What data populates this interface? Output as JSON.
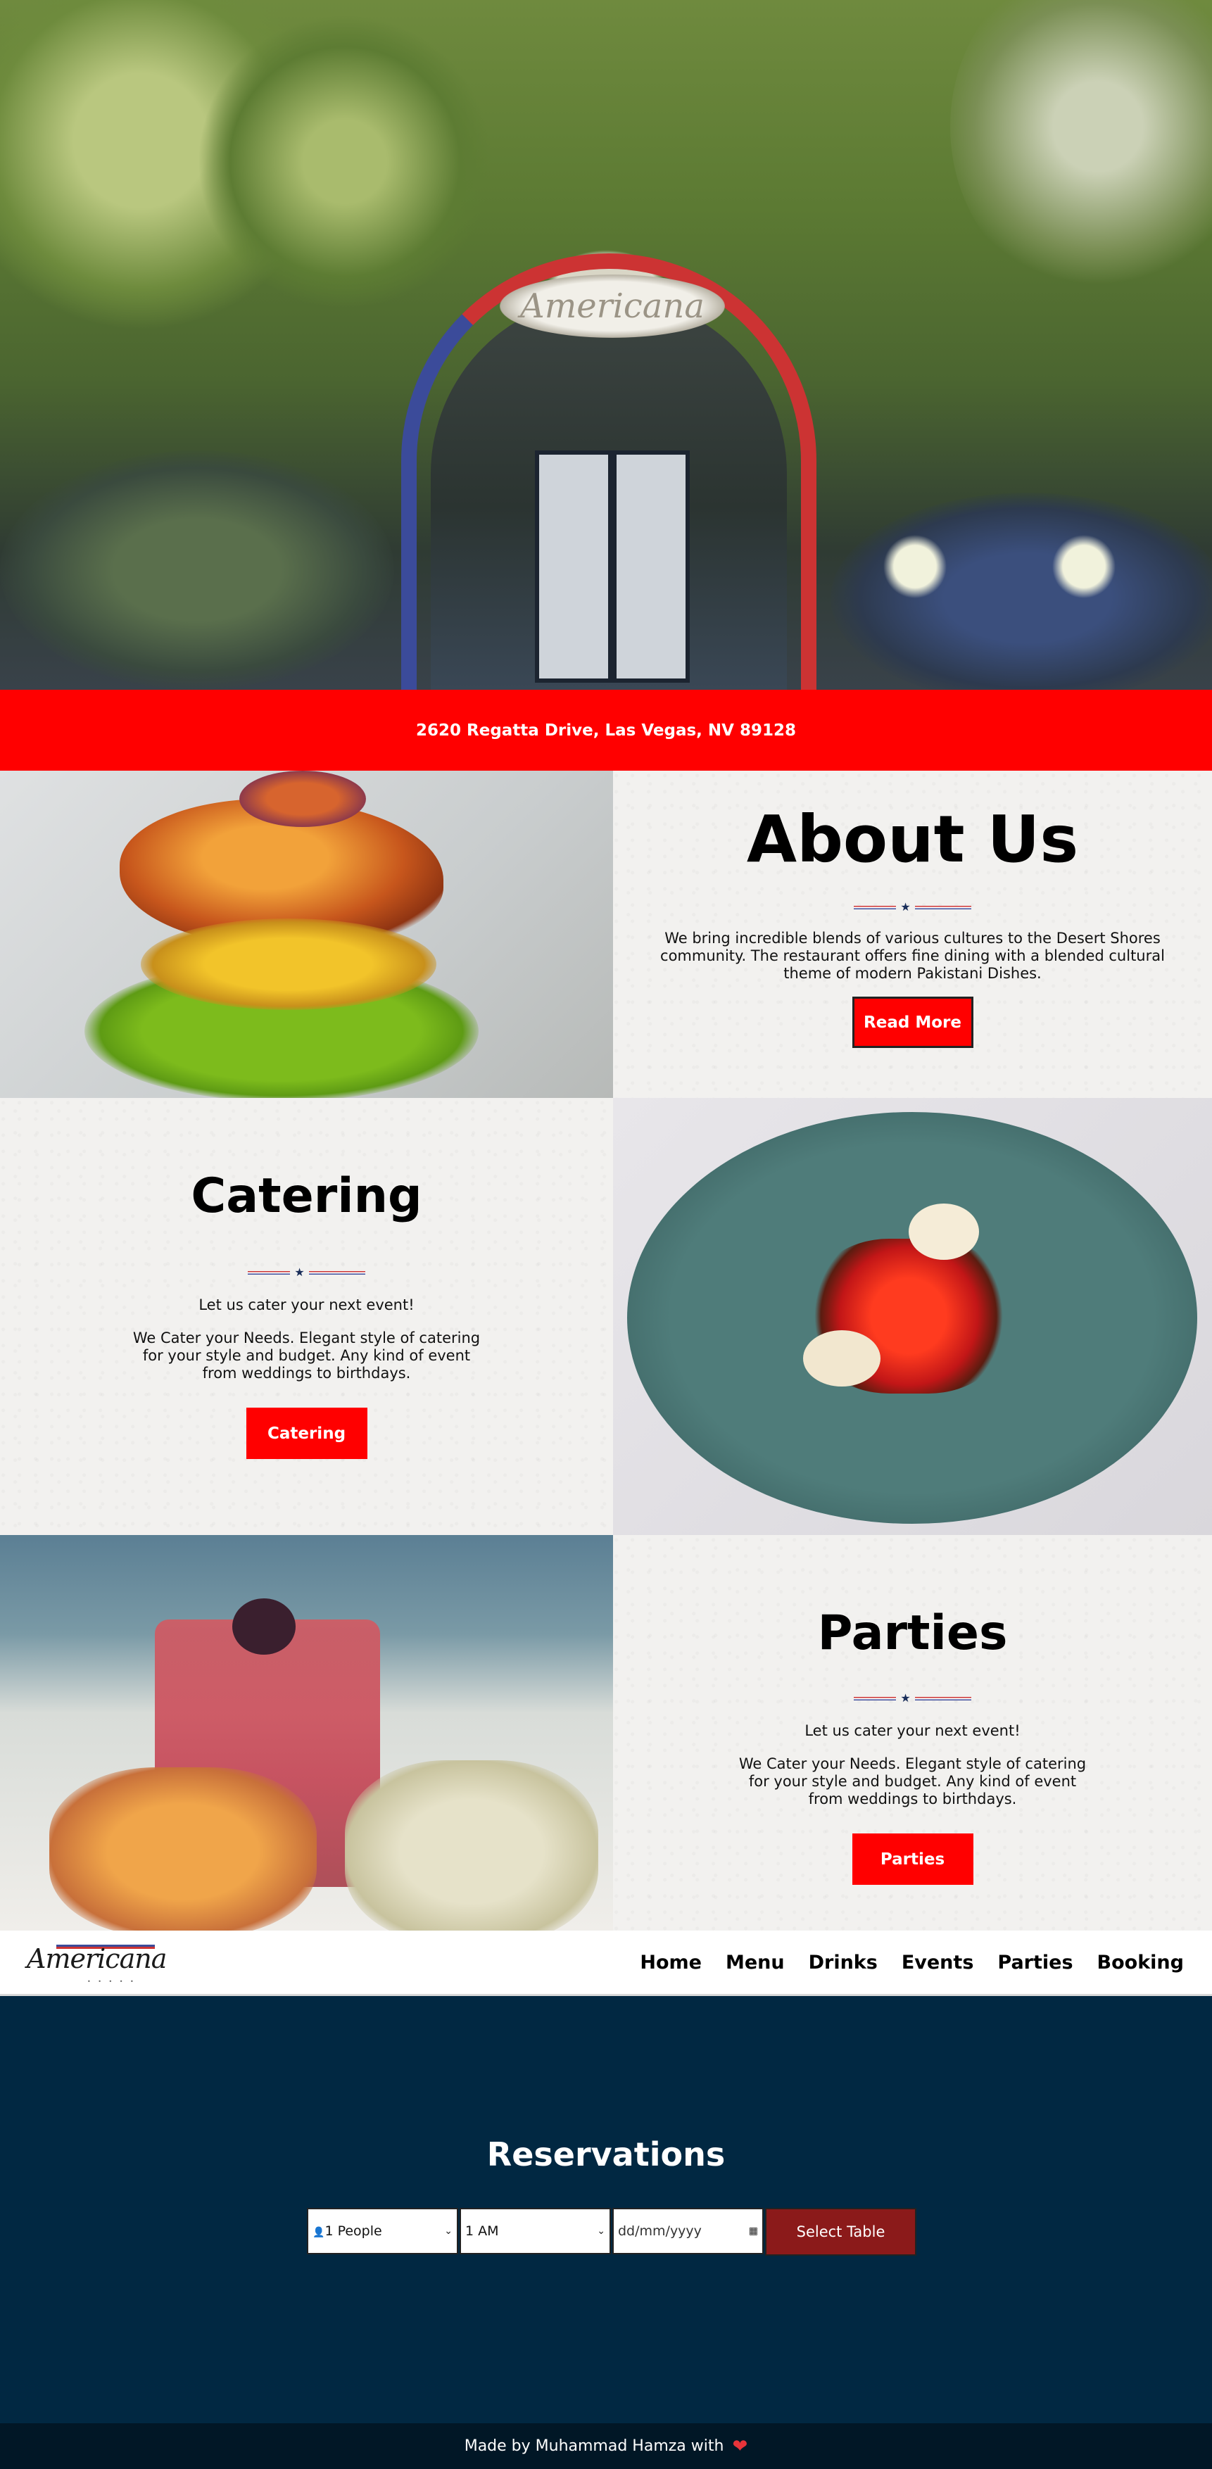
{
  "address": "2620 Regatta Drive, Las Vegas, NV 89128",
  "hero": {
    "sign_text": "Americana"
  },
  "about": {
    "title": "About Us",
    "text": "We bring incredible blends of various cultures to the Desert Shores community. The restaurant offers fine dining with a blended cultural theme of modern Pakistani Dishes.",
    "button": "Read More"
  },
  "catering": {
    "title": "Catering",
    "tagline": "Let us cater your next event!",
    "text": "We Cater your Needs. Elegant style of catering for your style and budget. Any kind of event from weddings to birthdays.",
    "button": "Catering"
  },
  "parties": {
    "title": "Parties",
    "tagline": "Let us cater your next event!",
    "text": "We Cater your Needs. Elegant style of catering for your style and budget. Any kind of event from weddings to birthdays.",
    "button": "Parties"
  },
  "nav": {
    "logo_text": "Americana",
    "links": [
      "Home",
      "Menu",
      "Drinks",
      "Events",
      "Parties",
      "Booking"
    ]
  },
  "reservations": {
    "title": "Reservations",
    "people": "1 People",
    "time": "1 AM",
    "date_placeholder": "dd/mm/yyyy",
    "button": "Select Table"
  },
  "footer": {
    "text": "Made by Muhammad Hamza with"
  },
  "colors": {
    "red": "#ff0000",
    "navy": "#012842",
    "footer": "#011726",
    "button_dark_red": "#8b1a1a"
  }
}
